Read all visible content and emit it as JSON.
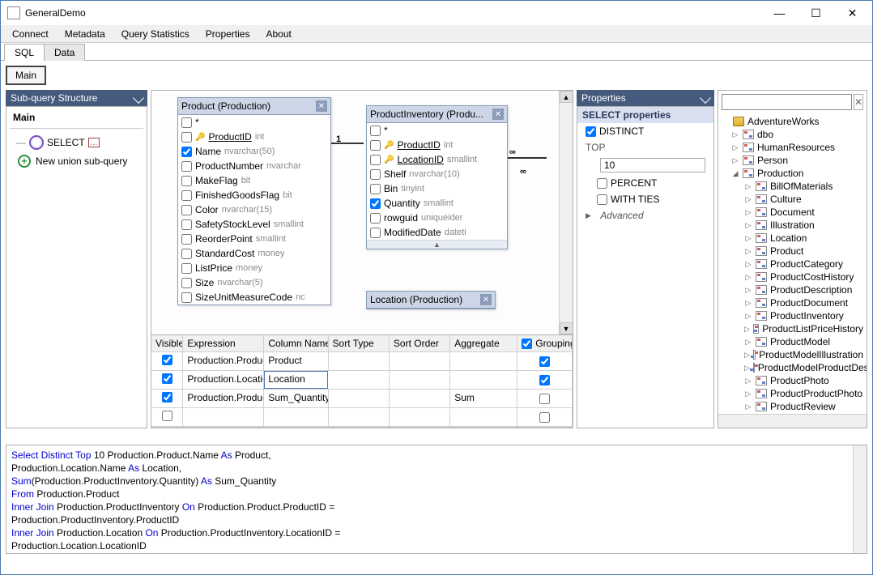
{
  "window": {
    "title": "GeneralDemo"
  },
  "menu": [
    "Connect",
    "Metadata",
    "Query Statistics",
    "Properties",
    "About"
  ],
  "view_tabs": [
    "SQL",
    "Data"
  ],
  "active_view_tab": 0,
  "main_tab": "Main",
  "subquery": {
    "title": "Sub-query Structure",
    "root": "Main",
    "select_label": "SELECT",
    "new_union": "New union sub-query"
  },
  "tables": {
    "product": {
      "title": "Product (Production)",
      "cols": [
        {
          "chk": false,
          "key": false,
          "name": "*",
          "type": ""
        },
        {
          "chk": false,
          "key": true,
          "name": "ProductID",
          "type": "int"
        },
        {
          "chk": true,
          "key": false,
          "name": "Name",
          "type": "nvarchar(50)"
        },
        {
          "chk": false,
          "key": false,
          "name": "ProductNumber",
          "type": "nvarchar"
        },
        {
          "chk": false,
          "key": false,
          "name": "MakeFlag",
          "type": "bit"
        },
        {
          "chk": false,
          "key": false,
          "name": "FinishedGoodsFlag",
          "type": "bit"
        },
        {
          "chk": false,
          "key": false,
          "name": "Color",
          "type": "nvarchar(15)"
        },
        {
          "chk": false,
          "key": false,
          "name": "SafetyStockLevel",
          "type": "smallint"
        },
        {
          "chk": false,
          "key": false,
          "name": "ReorderPoint",
          "type": "smallint"
        },
        {
          "chk": false,
          "key": false,
          "name": "StandardCost",
          "type": "money"
        },
        {
          "chk": false,
          "key": false,
          "name": "ListPrice",
          "type": "money"
        },
        {
          "chk": false,
          "key": false,
          "name": "Size",
          "type": "nvarchar(5)"
        },
        {
          "chk": false,
          "key": false,
          "name": "SizeUnitMeasureCode",
          "type": "nc"
        }
      ]
    },
    "productinv": {
      "title": "ProductInventory (Produ...",
      "cols": [
        {
          "chk": false,
          "key": false,
          "name": "*",
          "type": ""
        },
        {
          "chk": false,
          "key": true,
          "name": "ProductID",
          "type": "int"
        },
        {
          "chk": false,
          "key": true,
          "name": "LocationID",
          "type": "smallint"
        },
        {
          "chk": false,
          "key": false,
          "name": "Shelf",
          "type": "nvarchar(10)"
        },
        {
          "chk": false,
          "key": false,
          "name": "Bin",
          "type": "tinyint"
        },
        {
          "chk": true,
          "key": false,
          "name": "Quantity",
          "type": "smallint"
        },
        {
          "chk": false,
          "key": false,
          "name": "rowguid",
          "type": "uniqueider"
        },
        {
          "chk": false,
          "key": false,
          "name": "ModifiedDate",
          "type": "dateti"
        }
      ]
    },
    "location": {
      "title": "Location (Production)"
    }
  },
  "join_labels": {
    "one": "1",
    "inf": "∞"
  },
  "properties": {
    "title": "Properties",
    "section": "SELECT properties",
    "distinct": {
      "label": "DISTINCT",
      "checked": true
    },
    "top_label": "TOP",
    "top_value": "10",
    "percent": {
      "label": "PERCENT",
      "checked": false
    },
    "withties": {
      "label": "WITH TIES",
      "checked": false
    },
    "advanced": "Advanced"
  },
  "grid": {
    "headers": {
      "visible": "Visible",
      "expression": "Expression",
      "colname": "Column Name",
      "sorttype": "Sort Type",
      "sortorder": "Sort Order",
      "aggregate": "Aggregate",
      "grouping": "Grouping"
    },
    "grouping_checked": true,
    "rows": [
      {
        "visible": true,
        "expr": "Production.Product.Name",
        "col": "Product",
        "st": "",
        "so": "",
        "ag": "",
        "gr": true
      },
      {
        "visible": true,
        "expr": "Production.Location.Name",
        "col": "Location",
        "st": "",
        "so": "",
        "ag": "",
        "gr": true,
        "editing": true
      },
      {
        "visible": true,
        "expr": "Production.ProductInventory.Quantity",
        "col": "Sum_Quantity",
        "st": "",
        "so": "",
        "ag": "Sum",
        "gr": false
      }
    ]
  },
  "objexp": {
    "search_placeholder": "",
    "db": "AdventureWorks",
    "schemas": [
      {
        "name": "dbo",
        "expanded": false
      },
      {
        "name": "HumanResources",
        "expanded": false
      },
      {
        "name": "Person",
        "expanded": false
      },
      {
        "name": "Production",
        "expanded": true,
        "tables": [
          "BillOfMaterials",
          "Culture",
          "Document",
          "Illustration",
          "Location",
          "Product",
          "ProductCategory",
          "ProductCostHistory",
          "ProductDescription",
          "ProductDocument",
          "ProductInventory",
          "ProductListPriceHistory",
          "ProductModel",
          "ProductModelIllustration",
          "ProductModelProductDescriptionCulture",
          "ProductPhoto",
          "ProductProductPhoto",
          "ProductReview"
        ]
      }
    ]
  },
  "sql": {
    "l1a": "Select Distinct Top ",
    "l1b": "10 Production.Product.Name ",
    "l1c": "As ",
    "l1d": "Product,",
    "l2a": "  Production.Location.Name ",
    "l2b": "As ",
    "l2c": "Location,",
    "l3a": "  Sum",
    "l3b": "(Production.ProductInventory.Quantity) ",
    "l3c": "As ",
    "l3d": "Sum_Quantity",
    "l4a": "From ",
    "l4b": "Production.Product",
    "l5a": "  Inner Join ",
    "l5b": "Production.ProductInventory ",
    "l5c": "On ",
    "l5d": "Production.Product.ProductID =",
    "l6": "    Production.ProductInventory.ProductID",
    "l7a": "  Inner Join ",
    "l7b": "Production.Location ",
    "l7c": "On ",
    "l7d": "Production.ProductInventory.LocationID =",
    "l8": "    Production.Location.LocationID"
  }
}
